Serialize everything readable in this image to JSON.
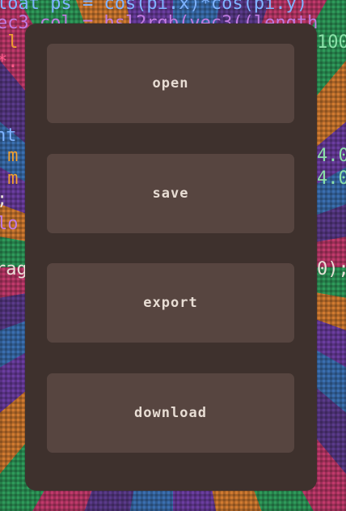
{
  "background_code": {
    "line1": "loat ps = cos(pi.x)*cos(pi.y)",
    "line2": "ec3 col = hsl2rgb(vec3((length",
    "line3a": " l",
    "line3b": "100",
    "line4": "*.",
    "line5": "nt",
    "line6a": " m",
    "line6b": "4.0",
    "line7a": " m",
    "line7b": "4.0",
    "line8": ";",
    "line9": "lo",
    "line10a": "rag",
    "line10b": "0);"
  },
  "menu": {
    "open_label": "open",
    "save_label": "save",
    "export_label": "export",
    "download_label": "download"
  },
  "colors": {
    "modal_bg": "#3e312d",
    "button_bg": "#574540",
    "button_text": "#e8ddd4"
  }
}
